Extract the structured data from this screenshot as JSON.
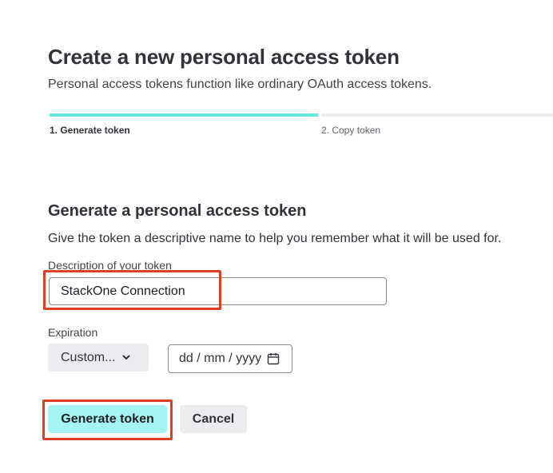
{
  "header": {
    "title": "Create a new personal access token",
    "subtitle": "Personal access tokens function like ordinary OAuth access tokens."
  },
  "stepper": {
    "steps": [
      {
        "label": "1. Generate token",
        "active": true
      },
      {
        "label": "2. Copy token",
        "active": false
      }
    ]
  },
  "form": {
    "title": "Generate a personal access token",
    "description": "Give the token a descriptive name to help you remember what it will be used for.",
    "token_description": {
      "label": "Description of your token",
      "value": "StackOne Connection"
    },
    "expiration": {
      "label": "Expiration",
      "selected": "Custom...",
      "date_placeholder": "dd / mm / yyyy"
    },
    "actions": {
      "generate_label": "Generate token",
      "cancel_label": "Cancel"
    }
  },
  "icons": {
    "dropdown": "chevron-down-icon",
    "date": "calendar-icon"
  },
  "colors": {
    "accent": "#63e6dc",
    "primary_button": "#a4f5f1",
    "highlight": "#dd3f25",
    "secondary_button": "#ececef"
  }
}
